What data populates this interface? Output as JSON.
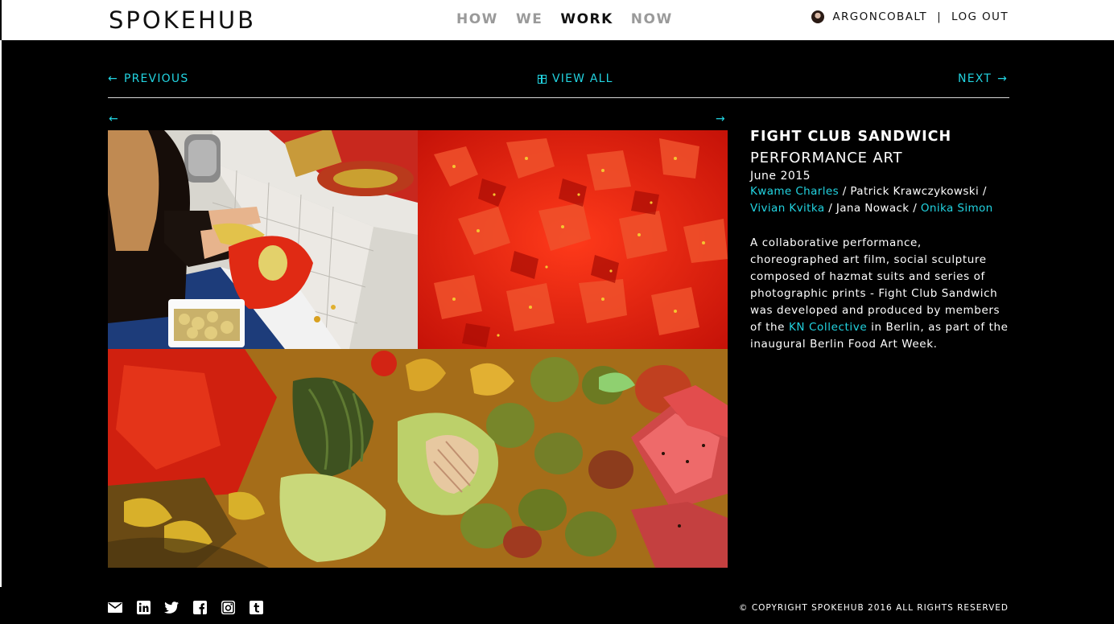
{
  "brand": {
    "logo": "SPOKEHUB"
  },
  "nav": [
    {
      "label": "HOW",
      "active": false
    },
    {
      "label": "WE",
      "active": false
    },
    {
      "label": "WORK",
      "active": true
    },
    {
      "label": "NOW",
      "active": false
    }
  ],
  "user": {
    "name": "ARGONCOBALT",
    "separator": "|",
    "logout": "LOG OUT"
  },
  "subnav": {
    "previous": "PREVIOUS",
    "view_all": "VIEW ALL",
    "next": "NEXT"
  },
  "project": {
    "title": "FIGHT CLUB SANDWICH",
    "category": "PERFORMANCE ART",
    "date": "June 2015",
    "credits": {
      "c1": "Kwame Charles",
      "s1": " / ",
      "c2": "Patrick Krawczykowski",
      "s2": " / ",
      "c3": "Vivian Kvitka",
      "s3": " / ",
      "c4": "Jana Nowack",
      "s4": " / ",
      "c5": "Onika Simon"
    },
    "description": {
      "part1": "A collaborative performance, choreographed art film, social sculpture composed of hazmat suits and series of photographic prints - Fight Club Sandwich was developed and produced by members of the ",
      "link": "KN Collective",
      "part2": " in Berlin, as part of the inaugural Berlin Food Art Week."
    }
  },
  "footer": {
    "social": [
      "mail-icon",
      "linkedin-icon",
      "twitter-icon",
      "facebook-icon",
      "instagram-icon",
      "tumblr-icon"
    ],
    "copyright": "© COPYRIGHT SPOKEHUB 2016 ALL RIGHTS RESERVED"
  },
  "colors": {
    "accent": "#22d3e0",
    "background": "#000000",
    "header": "#ffffff"
  }
}
